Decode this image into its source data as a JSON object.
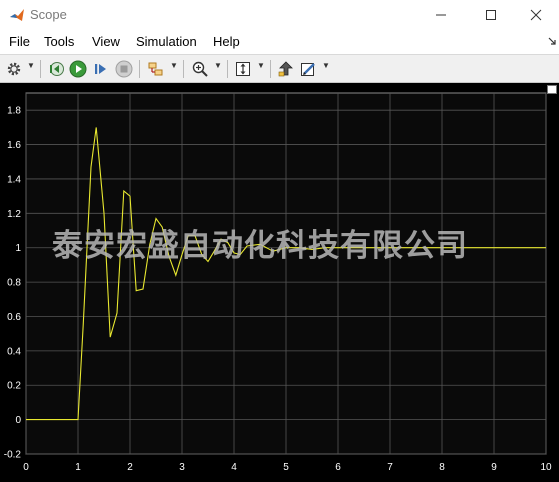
{
  "window": {
    "title": "Scope"
  },
  "menu": {
    "items": [
      "File",
      "Tools",
      "View",
      "Simulation",
      "Help"
    ]
  },
  "toolbar": {
    "icons": [
      "gear-icon",
      "step-back-icon",
      "run-icon",
      "step-forward-icon",
      "stop-icon",
      "signal-select-icon",
      "zoom-icon",
      "scale-axes-icon",
      "highlight-block-icon",
      "edit-icon"
    ]
  },
  "watermark": {
    "text": "泰安宏盛自动化科技有限公司"
  },
  "colors": {
    "plot_background": "#000000",
    "axes_background": "#0a0a0a",
    "grid": "#555555",
    "trace": "#e8e830",
    "tick_text": "#ffffff"
  },
  "chart_data": {
    "type": "line",
    "title": "",
    "xlabel": "",
    "ylabel": "",
    "xlim": [
      0,
      10
    ],
    "ylim": [
      -0.2,
      1.9
    ],
    "x_ticks": [
      0,
      1,
      2,
      3,
      4,
      5,
      6,
      7,
      8,
      9,
      10
    ],
    "y_ticks": [
      -0.2,
      0,
      0.2,
      0.4,
      0.6,
      0.8,
      1,
      1.2,
      1.4,
      1.6,
      1.8
    ],
    "x_tick_labels": [
      "0",
      "1",
      "2",
      "3",
      "4",
      "5",
      "6",
      "7",
      "8",
      "9",
      "10"
    ],
    "y_tick_labels": [
      "-0.2",
      "0",
      "0.2",
      "0.4",
      "0.6",
      "0.8",
      "1",
      "1.2",
      "1.4",
      "1.6",
      "1.8"
    ],
    "grid": true,
    "series": [
      {
        "x": [
          0,
          1.0,
          1.1,
          1.25,
          1.35,
          1.5,
          1.62,
          1.75,
          1.88,
          2.0,
          2.12,
          2.25,
          2.38,
          2.5,
          2.62,
          2.75,
          2.88,
          3.0,
          3.12,
          3.25,
          3.38,
          3.5,
          3.62,
          3.75,
          3.88,
          4.0,
          4.12,
          4.25,
          4.5,
          4.75,
          5.0,
          5.25,
          5.5,
          5.75,
          6.0,
          6.5,
          7.0,
          8.0,
          9.0,
          10.0
        ],
        "y": [
          0,
          0,
          0.55,
          1.47,
          1.7,
          1.2,
          0.48,
          0.62,
          1.33,
          1.3,
          0.75,
          0.76,
          1.02,
          1.17,
          1.12,
          0.95,
          0.84,
          0.96,
          1.07,
          1.07,
          0.96,
          0.92,
          0.98,
          1.05,
          1.03,
          0.97,
          0.96,
          1.01,
          1.02,
          0.98,
          1.0,
          1.0,
          0.99,
          1.0,
          1.0,
          1.0,
          1.0,
          1.0,
          1.0,
          1.0
        ]
      }
    ]
  }
}
